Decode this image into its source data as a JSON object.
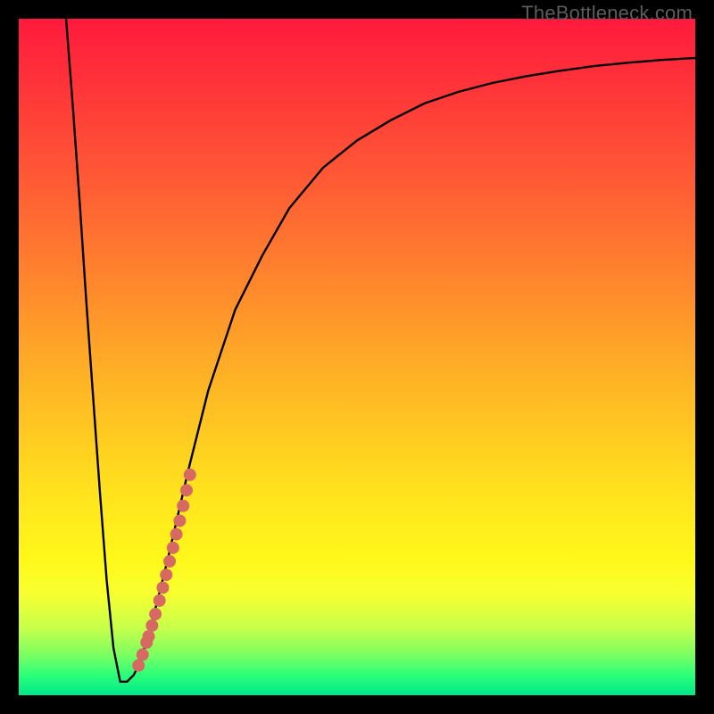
{
  "watermark": "TheBottleneck.com",
  "colors": {
    "frame": "#000000",
    "curve": "#000000",
    "points": "#d66a63",
    "gradient_top": "#ff1a3d",
    "gradient_mid_orange": "#ff8a2c",
    "gradient_mid_yellow": "#ffe21e",
    "gradient_bottom": "#00e88a"
  },
  "chart_data": {
    "type": "line",
    "title": "",
    "xlabel": "",
    "ylabel": "",
    "xlim": [
      0,
      100
    ],
    "ylim": [
      0,
      100
    ],
    "series": [
      {
        "name": "bottleneck-curve",
        "x": [
          7,
          8,
          9,
          10,
          11,
          12,
          13,
          14,
          15,
          16,
          17,
          18,
          20,
          22,
          25,
          28,
          32,
          36,
          40,
          45,
          50,
          55,
          60,
          65,
          70,
          75,
          80,
          85,
          90,
          95,
          100
        ],
        "y": [
          100,
          87,
          73,
          58,
          44,
          30,
          17,
          7,
          2,
          2,
          3,
          5,
          12,
          20,
          33,
          45,
          57,
          65,
          72,
          78,
          82,
          85,
          87.5,
          89.2,
          90.5,
          91.5,
          92.3,
          93,
          93.5,
          93.9,
          94.2
        ]
      }
    ],
    "points": {
      "name": "highlighted-range",
      "x": [
        17.7,
        18.3,
        18.9,
        19.2,
        19.7,
        20.2,
        20.8,
        21.3,
        21.8,
        22.3,
        22.8,
        23.3,
        23.8,
        24.3,
        24.8,
        25.3
      ],
      "y": [
        4.4,
        6.0,
        7.8,
        8.7,
        10.3,
        12.0,
        14.0,
        15.9,
        17.8,
        19.8,
        21.8,
        23.8,
        25.8,
        28.0,
        30.3,
        32.6
      ]
    }
  }
}
